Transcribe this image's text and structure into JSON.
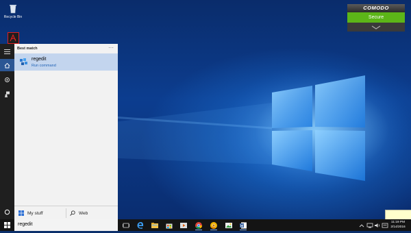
{
  "desktop": {
    "icons": [
      {
        "label": "Recycle Bin",
        "icon": "recycle-bin-icon"
      },
      {
        "label": "",
        "icon": "acrobat-reader-icon"
      }
    ]
  },
  "start_rail": {
    "items": [
      {
        "icon": "hamburger-menu-icon"
      },
      {
        "icon": "home-icon",
        "active": true
      },
      {
        "icon": "settings-icon"
      },
      {
        "icon": "feedback-icon"
      },
      {
        "icon": "cortana-icon"
      }
    ]
  },
  "search_panel": {
    "section_header": "Best match",
    "more_glyph": "···",
    "best_match": {
      "title": "regedit",
      "subtitle": "Run command",
      "icon": "regedit-icon"
    },
    "scopes": [
      {
        "label": "My stuff",
        "icon": "windows-logo-icon"
      },
      {
        "label": "Web",
        "icon": "search-icon"
      }
    ]
  },
  "taskbar": {
    "search_value": "regedit",
    "apps": [
      "task-view-icon",
      "edge-icon",
      "file-explorer-icon",
      "store-icon",
      "media-player-icon",
      "chrome-icon",
      "chrome-canary-icon",
      "photos-icon",
      "mail-icon",
      "word-icon"
    ],
    "tray_icons": [
      "chevron-up-icon",
      "network-icon",
      "volume-icon",
      "action-center-icon"
    ],
    "time": "11:19 PM",
    "date": "2/14/2016"
  },
  "comodo": {
    "title": "COMODO",
    "status": "Secure",
    "colors": {
      "secure": "#5cb518",
      "header": "#2f2f2f"
    }
  },
  "colors": {
    "accent": "#2b5694",
    "selection": "#c3d5ee",
    "link": "#1f62b6"
  }
}
